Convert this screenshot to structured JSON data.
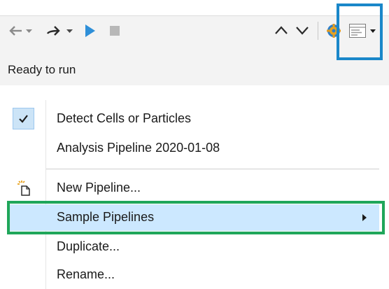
{
  "toolbar": {
    "icons": [
      "undo-icon",
      "undo-dropdown-icon",
      "redo-icon",
      "redo-dropdown-icon",
      "run-icon",
      "stop-icon",
      "move-up-icon",
      "move-down-icon",
      "settings-icon",
      "pipeline-menu-icon"
    ],
    "colors": {
      "run": "#2e8fd8",
      "stop": "#b8b8b8",
      "disabled": "#8a8a8a",
      "highlight": "#1a87c9"
    }
  },
  "status": {
    "text": "Ready to run"
  },
  "menu": {
    "items": [
      {
        "label": "Detect Cells or Particles",
        "checked": true
      },
      {
        "label": "Analysis Pipeline 2020-01-08"
      },
      {
        "label": "New Pipeline...",
        "icon": "new-pipeline-icon"
      },
      {
        "label": "Sample Pipelines",
        "selected": true,
        "submenu": true
      },
      {
        "label": "Duplicate..."
      },
      {
        "label": "Rename..."
      }
    ],
    "colors": {
      "selected_bg": "#cce8ff",
      "highlight": "#1fa65a"
    }
  }
}
